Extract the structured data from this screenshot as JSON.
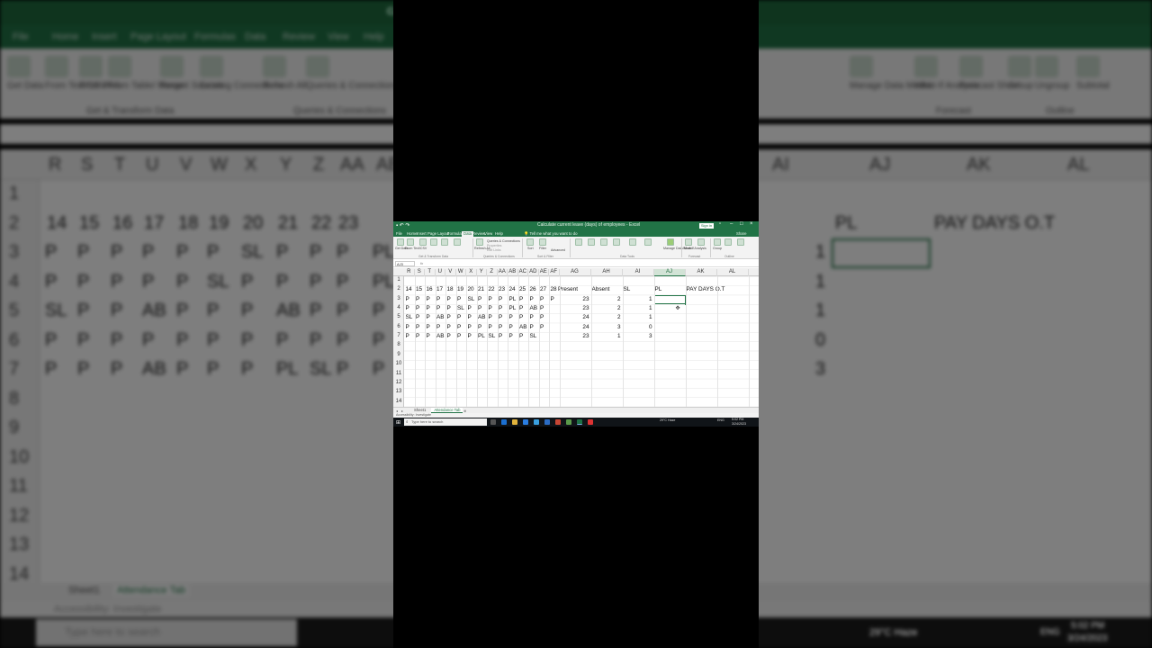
{
  "window": {
    "title": "Calculate current leave (days) of employees - Excel",
    "signin": "Sign in",
    "share": "Share"
  },
  "menu": [
    "File",
    "Home",
    "Insert",
    "Page Layout",
    "Formulas",
    "Data",
    "Review",
    "View",
    "Help"
  ],
  "menu_active": "Data",
  "tell_me": "Tell me what you want to do",
  "ribbon": {
    "get_data": "Get Data",
    "from_text": "From Text/CSV",
    "from_web": "From Web",
    "from_table": "From Table/ Range",
    "recent_sources": "Recent Sources",
    "existing_conn": "Existing Connections",
    "group_get": "Get & Transform Data",
    "refresh_all": "Refresh All",
    "queries": "Queries & Connections",
    "properties": "Properties",
    "edit_links": "Edit Links",
    "group_queries": "Queries & Connections",
    "sort": "Sort",
    "filter": "Filter",
    "advanced": "Advanced",
    "group_sort": "Sort & Filter",
    "text_to_columns": "Text to Columns",
    "flash_fill": "Flash Fill",
    "remove_dup": "Remove Duplicates",
    "validation": "Data Validation",
    "consolidate": "Consolidate",
    "relationships": "Relationships",
    "manage_model": "Manage Data Model",
    "group_tools": "Data Tools",
    "what_if": "What-If Analysis",
    "forecast": "Forecast Sheet",
    "group_forecast": "Forecast",
    "group": "Group",
    "ungroup": "Ungroup",
    "subtotal": "Subtotal",
    "group_outline": "Outline"
  },
  "name_box": "AJ3",
  "fx": "fx",
  "columns": [
    "R",
    "S",
    "T",
    "U",
    "V",
    "W",
    "X",
    "Y",
    "Z",
    "AA",
    "AB",
    "AC",
    "AD",
    "AE",
    "AF",
    "AG",
    "AH",
    "AI",
    "AJ",
    "AK",
    "AL"
  ],
  "selected_column": "AJ",
  "row_numbers": [
    "1",
    "2",
    "3",
    "4",
    "5",
    "6",
    "7",
    "8",
    "9",
    "10",
    "11",
    "12",
    "13",
    "14"
  ],
  "header_row": {
    "days": [
      "14",
      "15",
      "16",
      "17",
      "18",
      "19",
      "20",
      "21",
      "22",
      "23",
      "24",
      "25",
      "26",
      "27",
      "28"
    ],
    "present": "Present",
    "absent": "Absent",
    "sl": "SL",
    "pl": "PL",
    "pay_days_ot": "PAY DAYS O.T"
  },
  "rows": [
    {
      "codes": [
        "P",
        "P",
        "P",
        "P",
        "P",
        "P",
        "SL",
        "P",
        "P",
        "P",
        "PL",
        "P",
        "P",
        "P",
        "P"
      ],
      "present": "23",
      "absent": "2",
      "sl": "1"
    },
    {
      "codes": [
        "P",
        "P",
        "P",
        "P",
        "P",
        "SL",
        "P",
        "P",
        "P",
        "P",
        "PL",
        "P",
        "AB",
        "P",
        ""
      ],
      "present": "23",
      "absent": "2",
      "sl": "1"
    },
    {
      "codes": [
        "SL",
        "P",
        "P",
        "AB",
        "P",
        "P",
        "P",
        "AB",
        "P",
        "P",
        "P",
        "P",
        "P",
        "P",
        ""
      ],
      "present": "24",
      "absent": "2",
      "sl": "1"
    },
    {
      "codes": [
        "P",
        "P",
        "P",
        "P",
        "P",
        "P",
        "P",
        "P",
        "P",
        "P",
        "P",
        "AB",
        "P",
        "P",
        ""
      ],
      "present": "24",
      "absent": "3",
      "sl": "0"
    },
    {
      "codes": [
        "P",
        "P",
        "P",
        "AB",
        "P",
        "P",
        "P",
        "PL",
        "SL",
        "P",
        "P",
        "P",
        "SL",
        "",
        ""
      ],
      "present": "23",
      "absent": "1",
      "sl": "3"
    }
  ],
  "sheets": [
    "Sheet1",
    "Attendance Tab"
  ],
  "active_sheet": "Attendance Tab",
  "status": "Accessibility: Investigate",
  "taskbar": {
    "search_placeholder": "Type here to search",
    "weather": "29°C Haze",
    "lang": "ENG",
    "time": "5:02 PM",
    "date": "3/24/2023"
  },
  "background_zoom": {
    "title": "Calculate current leave (days) of employees - Excel",
    "tabs": [
      "File",
      "Home",
      "Insert",
      "Page Layout",
      "Formulas",
      "Data",
      "Review",
      "View",
      "Help"
    ],
    "ribbon_labels": [
      "Get Data",
      "From Text/CSV",
      "From Web",
      "From Table/ Range",
      "Recent Sources",
      "Existing Connections",
      "Refresh All",
      "Queries & Connections",
      "Manage Data Model",
      "What-If Analysis",
      "Forecast Sheet",
      "Group",
      "Ungroup",
      "Subtotal"
    ],
    "group_labels": [
      "Get & Transform Data",
      "Queries & Connections",
      "Forecast",
      "Outline"
    ],
    "columns_left": [
      "R",
      "S",
      "T",
      "U",
      "V",
      "W",
      "X",
      "Y",
      "Z",
      "AA",
      "AB"
    ],
    "columns_right": [
      "AI",
      "AJ",
      "AK",
      "AL"
    ],
    "days": [
      "14",
      "15",
      "16",
      "17",
      "18",
      "19",
      "20",
      "21",
      "22",
      "23"
    ],
    "rows": [
      [
        "P",
        "P",
        "P",
        "P",
        "P",
        "P",
        "SL",
        "P",
        "P",
        "P",
        "PL"
      ],
      [
        "P",
        "P",
        "P",
        "P",
        "P",
        "SL",
        "P",
        "P",
        "P",
        "P",
        "PL"
      ],
      [
        "SL",
        "P",
        "P",
        "AB",
        "P",
        "P",
        "P",
        "AB",
        "P",
        "P",
        "P"
      ],
      [
        "P",
        "P",
        "P",
        "P",
        "P",
        "P",
        "P",
        "P",
        "P",
        "P",
        "P"
      ],
      [
        "P",
        "P",
        "P",
        "AB",
        "P",
        "P",
        "P",
        "PL",
        "SL",
        "P",
        "P"
      ]
    ],
    "sl_values": [
      "1",
      "1",
      "1",
      "0",
      "3"
    ],
    "pl_label": "PL",
    "paydays_label": "PAY DAYS O.T",
    "row_numbers": [
      "1",
      "2",
      "3",
      "4",
      "5",
      "6",
      "7",
      "8",
      "9",
      "10",
      "11",
      "12",
      "13",
      "14"
    ],
    "sheets": [
      "Sheet1",
      "Attendance Tab"
    ],
    "status": "Accessibility: Investigate",
    "search_placeholder": "Type here to search",
    "weather": "29°C Haze",
    "lang": "ENG",
    "time": "5:02 PM",
    "date": "3/24/2023"
  }
}
